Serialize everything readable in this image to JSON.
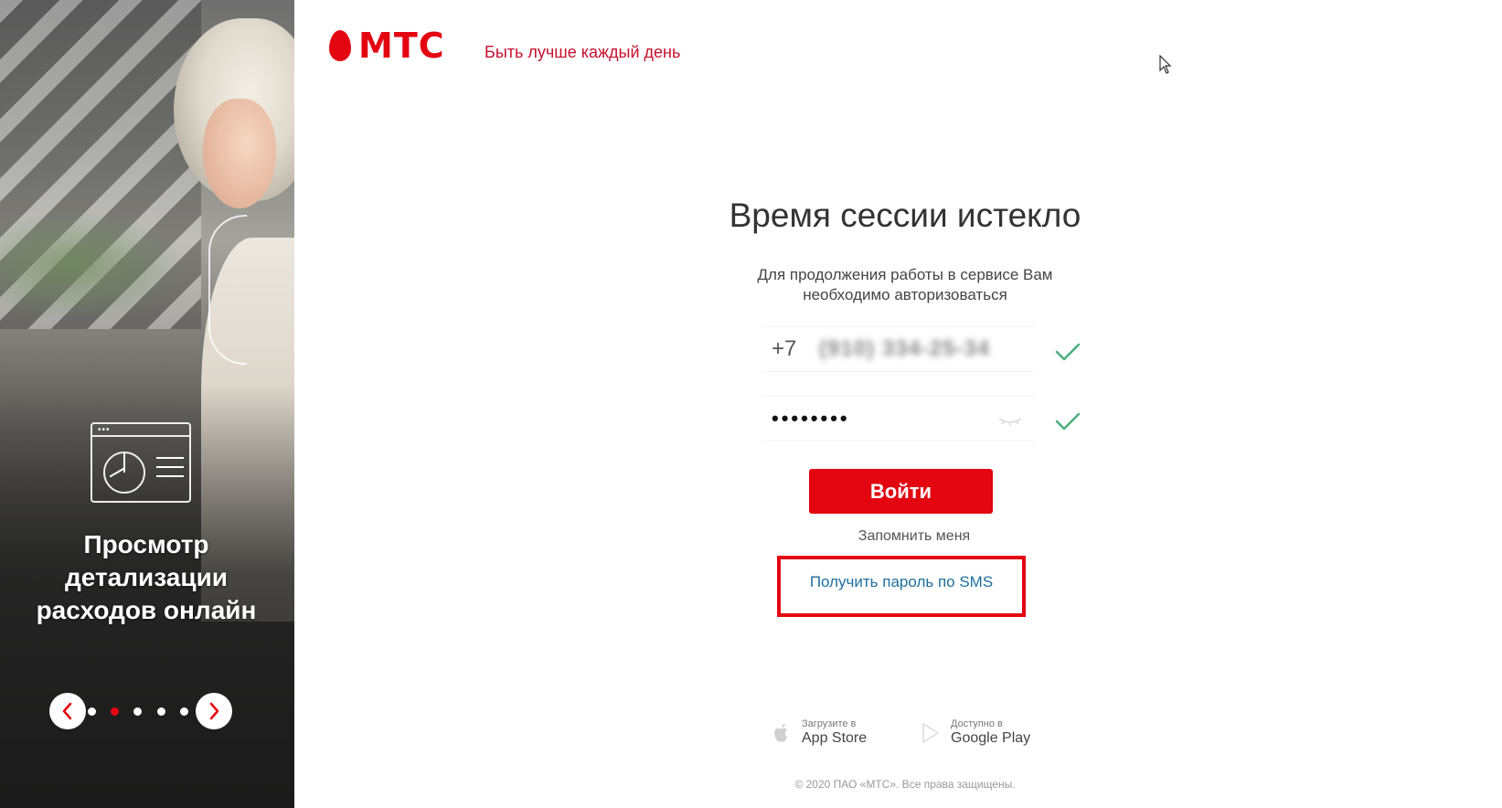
{
  "colors": {
    "brand_red": "#e30611",
    "link_blue": "#1f6e9c",
    "check_green": "#4caf7d"
  },
  "promo": {
    "icon": "analytics-window-icon",
    "title_lines": [
      "Просмотр",
      "детализации",
      "расходов онлайн"
    ],
    "carousel": {
      "dots_count": 5,
      "active_index": 1,
      "prev_icon": "chevron-left-icon",
      "next_icon": "chevron-right-icon"
    }
  },
  "header": {
    "logo_text": "МТС",
    "tagline": "Быть лучше каждый день"
  },
  "form": {
    "title": "Время сессии истекло",
    "subtitle_line1": "Для продолжения работы в сервисе Вам",
    "subtitle_line2": "необходимо авторизоваться",
    "phone_prefix": "+7",
    "phone_value": "(910) 334-25-34",
    "password_mask": "••••••••",
    "login_button": "Войти",
    "remember_me": "Запомнить меня",
    "sms_link": "Получить пароль по SMS"
  },
  "stores": {
    "appstore_small": "Загрузите в",
    "appstore_big": "App Store",
    "google_small": "Доступно в",
    "google_big": "Google Play"
  },
  "footer": {
    "copyright": "© 2020 ПАО «МТС». Все права защищены."
  }
}
